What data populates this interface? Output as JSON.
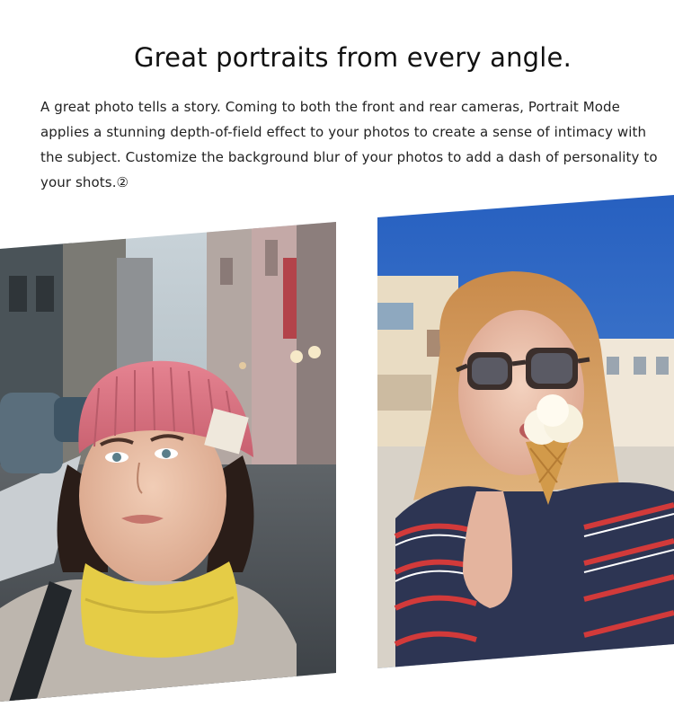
{
  "headline": "Great portraits from every angle.",
  "body_text": "A great photo tells a story. Coming to both the front and rear cameras, Portrait Mode applies a stunning depth-of-field effect to your photos to create a sense of intimacy with the subject. Customize the background blur of your photos to add a dash of personality to your shots.②",
  "photos": {
    "left": {
      "subject": "woman-pink-beanie-street-portrait"
    },
    "right": {
      "subject": "woman-sunglasses-ice-cream-portrait"
    }
  },
  "colors": {
    "background": "#ffffff",
    "text": "#111111",
    "beanie": "#d9707e",
    "scarf": "#e8d24a",
    "sky": "#2f6fcf"
  }
}
